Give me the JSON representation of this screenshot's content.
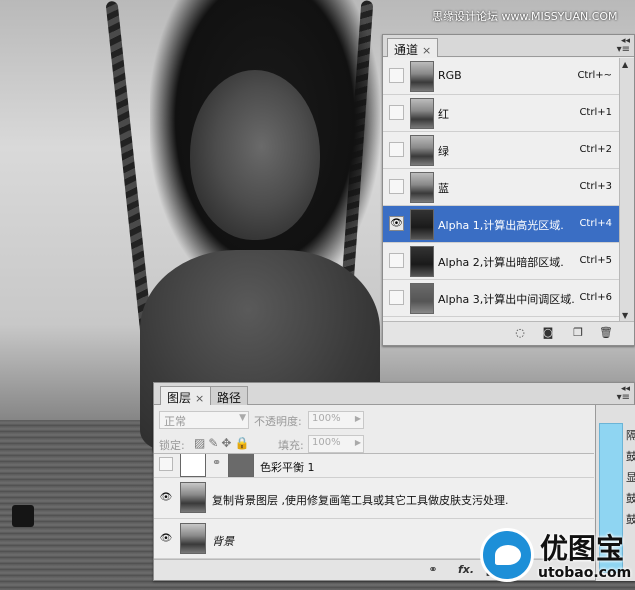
{
  "watermark_top": "思缘设计论坛 www.MISSYUAN.COM",
  "channels_panel": {
    "tab_label": "通道",
    "channels": [
      {
        "name": "RGB",
        "shortcut": "Ctrl+~"
      },
      {
        "name": "红",
        "shortcut": "Ctrl+1"
      },
      {
        "name": "绿",
        "shortcut": "Ctrl+2"
      },
      {
        "name": "蓝",
        "shortcut": "Ctrl+3"
      },
      {
        "name": "Alpha 1,计算出高光区域.",
        "shortcut": "Ctrl+4"
      },
      {
        "name": "Alpha 2,计算出暗部区域.",
        "shortcut": "Ctrl+5"
      },
      {
        "name": "Alpha 3,计算出中间调区域.",
        "shortcut": "Ctrl+6"
      }
    ],
    "selected_index": 4
  },
  "layers_panel": {
    "tabs": [
      "图层",
      "路径"
    ],
    "blend_mode": "正常",
    "opacity_label": "不透明度:",
    "opacity_value": "100%",
    "lock_label": "锁定:",
    "fill_label": "填充:",
    "fill_value": "100%",
    "layers": [
      {
        "name": "色彩平衡 1"
      },
      {
        "name": "复制背景图层 ,使用修复画笔工具或其它工具做皮肤支污处理."
      },
      {
        "name": "背景"
      }
    ],
    "footer_fx": "fx."
  },
  "side_strip_chars": [
    "隔",
    "鼓",
    "显",
    "鼓",
    "鼓"
  ],
  "logo": {
    "cn": "优图宝",
    "en": "utobao.com"
  },
  "colors": {
    "selection": "#3a6ec4",
    "panel_bg": "#ececec",
    "logo_blue": "#1d8fd8",
    "side_bar": "#8fd5f2"
  }
}
